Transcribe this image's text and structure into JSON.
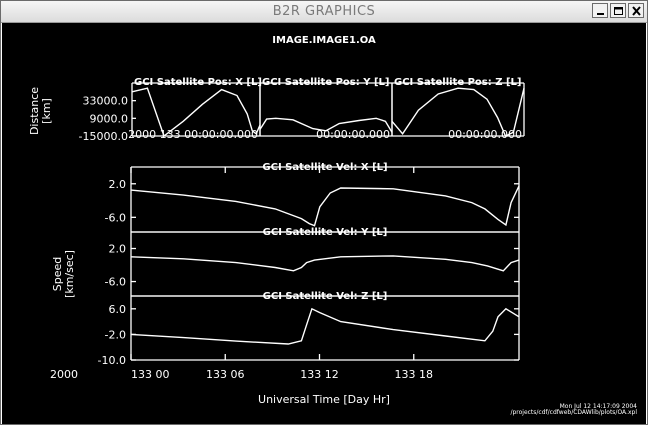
{
  "window": {
    "title": "B2R GRAPHICS"
  },
  "plot": {
    "main_title": "IMAGE.IMAGE1.OA",
    "pos_ylabel_1": "Distance",
    "pos_ylabel_2": "[km]",
    "vel_ylabel_1": "Speed",
    "vel_ylabel_2": "[km/sec]",
    "xlabel": "Universal Time   [Day Hr]",
    "footer_1": "Mon Jul 12 14:17:09 2004",
    "footer_2": "/projects/cdf/cdfweb/CDAWlib/plots/OA.xpl"
  },
  "chart_data": [
    {
      "type": "line",
      "title": "GCI Satellite Pos: X [L]",
      "ylabel": "Distance [km]",
      "yticks": [
        "33000.0",
        "9000.0",
        "-15000.0"
      ],
      "ylim": [
        -15000,
        57000
      ],
      "xlabel": "2000 133 00:00:00.000",
      "x": [
        0,
        0.12,
        0.25,
        0.4,
        0.55,
        0.7,
        0.82,
        0.9,
        0.94,
        0.97,
        1.0
      ],
      "values": [
        45000,
        50000,
        -15000,
        5000,
        28000,
        48000,
        40000,
        15000,
        -8000,
        -12000,
        0
      ]
    },
    {
      "type": "line",
      "title": "GCI Satellite Pos: Y [L]",
      "ylabel": "Distance [km]",
      "yticks": [],
      "ylim": [
        -15000,
        57000
      ],
      "xlabel": "00:00:00.000",
      "x": [
        0,
        0.05,
        0.12,
        0.25,
        0.4,
        0.5,
        0.6,
        0.75,
        0.88,
        0.95,
        1.0
      ],
      "values": [
        -6000,
        8000,
        9000,
        7000,
        -5000,
        -8000,
        2000,
        6000,
        9000,
        5000,
        -10000
      ]
    },
    {
      "type": "line",
      "title": "GCI Satellite Pos: Z [L]",
      "ylabel": "Distance [km]",
      "yticks": [],
      "ylim": [
        -15000,
        57000
      ],
      "xlabel": "00:00:00.000",
      "x": [
        0,
        0.08,
        0.2,
        0.35,
        0.5,
        0.62,
        0.72,
        0.8,
        0.86,
        0.92,
        1.0
      ],
      "values": [
        5000,
        -12000,
        20000,
        42000,
        50000,
        48000,
        35000,
        10000,
        -15000,
        -10000,
        50000
      ]
    },
    {
      "type": "line",
      "title": "GCI Satellite Vel: X [L]",
      "ylabel": "Speed [km/sec]",
      "yticks": [
        "2.0",
        "-6.0"
      ],
      "ylim": [
        -9.5,
        6
      ],
      "x": [
        0,
        20,
        40,
        55,
        65,
        68,
        70,
        72,
        76,
        80,
        100,
        120,
        130,
        135,
        140,
        143,
        145,
        148
      ],
      "values": [
        0.5,
        -0.7,
        -2.2,
        -4.0,
        -6.3,
        -7.5,
        -8.0,
        -3.5,
        -0.2,
        1.0,
        0.8,
        -0.9,
        -2.5,
        -4.0,
        -6.5,
        -7.8,
        -2.5,
        1.5
      ]
    },
    {
      "type": "line",
      "title": "GCI Satellite Vel: Y [L]",
      "ylabel": "Speed [km/sec]",
      "yticks": [
        "2.0",
        "-6.0"
      ],
      "ylim": [
        -9.5,
        6
      ],
      "x": [
        0,
        20,
        40,
        55,
        62,
        65,
        67,
        70,
        80,
        100,
        120,
        130,
        136,
        140,
        142,
        145,
        148
      ],
      "values": [
        0.0,
        -0.5,
        -1.4,
        -2.6,
        -3.4,
        -2.6,
        -1.4,
        -0.8,
        0.0,
        0.2,
        -0.6,
        -1.4,
        -2.2,
        -3.0,
        -3.4,
        -1.4,
        -0.8
      ]
    },
    {
      "type": "line",
      "title": "GCI Satellite Vel: Z [L]",
      "ylabel": "Speed [km/sec]",
      "yticks": [
        "6.0",
        "-2.0",
        "-10.0"
      ],
      "ylim": [
        -10,
        10
      ],
      "x": [
        0,
        20,
        40,
        60,
        65,
        67,
        69,
        72,
        80,
        100,
        120,
        135,
        138,
        140,
        143,
        148
      ],
      "values": [
        -2.0,
        -3.0,
        -4.1,
        -5.0,
        -4.0,
        1.0,
        6.0,
        4.8,
        2.0,
        -0.5,
        -2.5,
        -4.0,
        -1.0,
        3.5,
        6.0,
        3.5
      ]
    },
    {
      "type": "axis",
      "xlabel": "Universal Time   [Day Hr]",
      "xticks": [
        "133 00",
        "133 06",
        "133 12",
        "133 18"
      ],
      "xtick_values": [
        0,
        6,
        12,
        18
      ],
      "xlim": [
        0,
        24.7
      ],
      "prefix": "2000"
    }
  ]
}
